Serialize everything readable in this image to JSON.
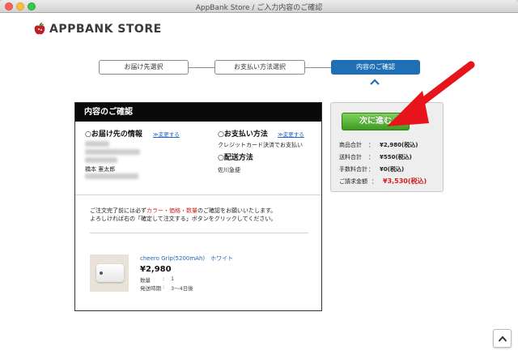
{
  "window": {
    "title": "AppBank Store / ご入力内容のご確認"
  },
  "logo": {
    "text": "APPBANK STORE",
    "icon": "apple-logo-icon"
  },
  "steps": [
    {
      "label": "お届け先選択",
      "active": false
    },
    {
      "label": "お支払い方法選択",
      "active": false
    },
    {
      "label": "内容のご確認",
      "active": true
    }
  ],
  "panel": {
    "title": "内容のご確認",
    "shipping": {
      "heading": "○お届け先の情報",
      "change": "≫変更する",
      "name": "橋本 憲太郎"
    },
    "payment": {
      "heading": "○お支払い方法",
      "change": "≫変更する",
      "method": "クレジットカード決済でお支払い"
    },
    "delivery": {
      "heading": "○配送方法",
      "carrier": "佐川急便"
    },
    "notice": {
      "line1_pre": "ご注文完了前には必ず",
      "line1_highlight": "カラー・価格・数量",
      "line1_post": "のご確認をお願いいたします。",
      "line2": "よろしければ右の「確定して注文する」ボタンをクリックしてください。"
    },
    "product": {
      "name": "cheero Grip(5200mAh)　ホワイト",
      "price": "¥2,980",
      "qty_label": "数量",
      "qty_sep": ":",
      "qty_value": "1",
      "ship_label": "発送時期",
      "ship_sep": ":",
      "ship_value": "3〜4日後"
    }
  },
  "summary": {
    "next_button": "次に進む",
    "rows": [
      {
        "label": "商品合計",
        "sep": "：",
        "value": "¥2,980(税込)"
      },
      {
        "label": "送料合計",
        "sep": "：",
        "value": "¥550(税込)"
      },
      {
        "label": "手数料合計",
        "sep": "：",
        "value": "¥0(税込)"
      },
      {
        "label": "ご請求金額",
        "sep": "：",
        "value": "¥3,530(税込)"
      }
    ]
  },
  "colors": {
    "accent": "#1e6fb5",
    "next_button": "#4fae2f",
    "highlight": "#d11f1f",
    "arrow": "#e8141b"
  },
  "scroll_top": {
    "icon": "chevron-up-icon",
    "glyph": "^"
  }
}
